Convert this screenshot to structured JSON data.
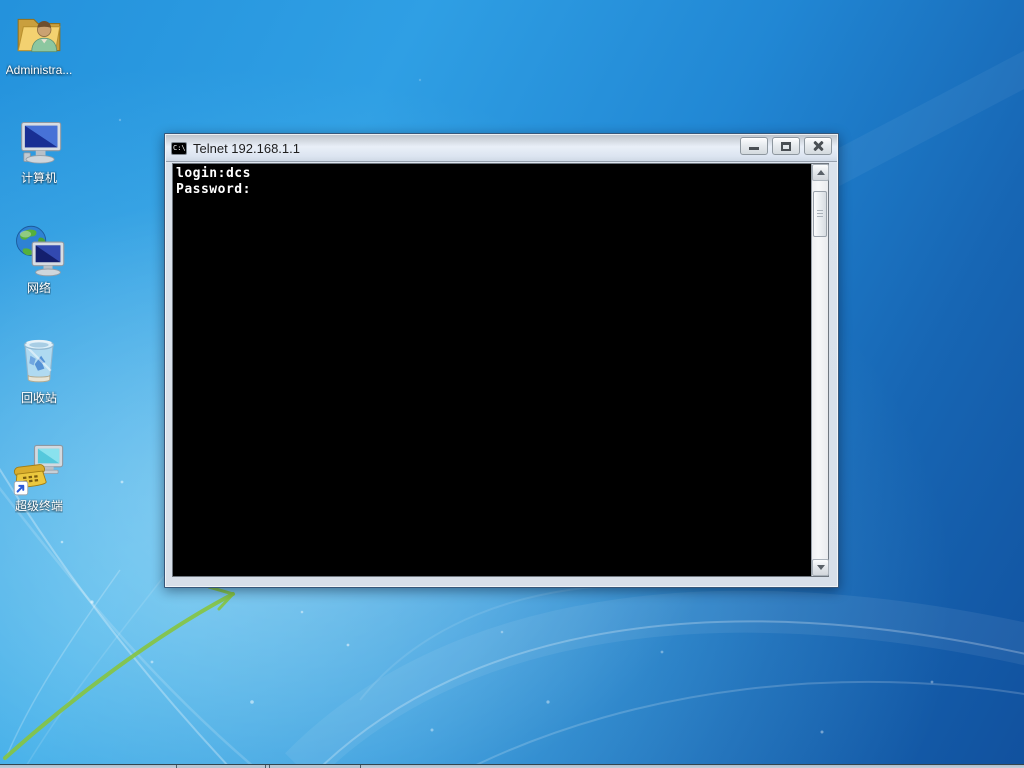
{
  "desktop": {
    "icons": [
      {
        "label": "Administra..."
      },
      {
        "label": "计算机"
      },
      {
        "label": "网络"
      },
      {
        "label": "回收站"
      },
      {
        "label": "超级终端"
      }
    ]
  },
  "window": {
    "title": "Telnet 192.168.1.1",
    "icon_text": "C:\\",
    "console_lines": [
      "login:dcs",
      "Password:"
    ]
  },
  "colors": {
    "console_bg": "#000000",
    "console_text": "#ffffff",
    "titlebar_light": "#e9eff8",
    "titlebar_dark": "#bfc5cc",
    "wallpaper_top_right": "#11519e",
    "wallpaper_bright": "#45b5ec",
    "wallpaper_green_streak": "#86c440"
  }
}
